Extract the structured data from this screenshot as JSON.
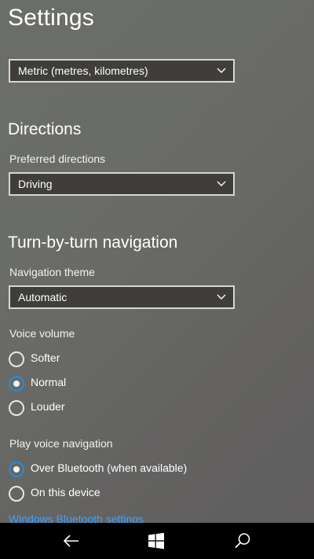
{
  "page": {
    "title": "Settings"
  },
  "units": {
    "selected": "Metric (metres, kilometres)"
  },
  "directions": {
    "title": "Directions",
    "preferred_label": "Preferred directions",
    "preferred_value": "Driving"
  },
  "turn_by_turn": {
    "title": "Turn-by-turn navigation",
    "theme_label": "Navigation theme",
    "theme_value": "Automatic",
    "volume_label": "Voice volume",
    "volume_options": [
      {
        "label": "Softer",
        "selected": false
      },
      {
        "label": "Normal",
        "selected": true
      },
      {
        "label": "Louder",
        "selected": false
      }
    ],
    "play_label": "Play voice navigation",
    "play_options": [
      {
        "label": "Over Bluetooth (when available)",
        "selected": true
      },
      {
        "label": "On this device",
        "selected": false
      }
    ],
    "bluetooth_link": "Windows Bluetooth settings"
  },
  "navbar": {
    "icons": [
      "back-arrow-icon",
      "windows-start-icon",
      "search-icon"
    ]
  },
  "colors": {
    "accent": "#2b8ad6",
    "link": "#3da2ff",
    "dropdown_bg": "#3f3e3c",
    "navbar_bg": "#000000"
  }
}
